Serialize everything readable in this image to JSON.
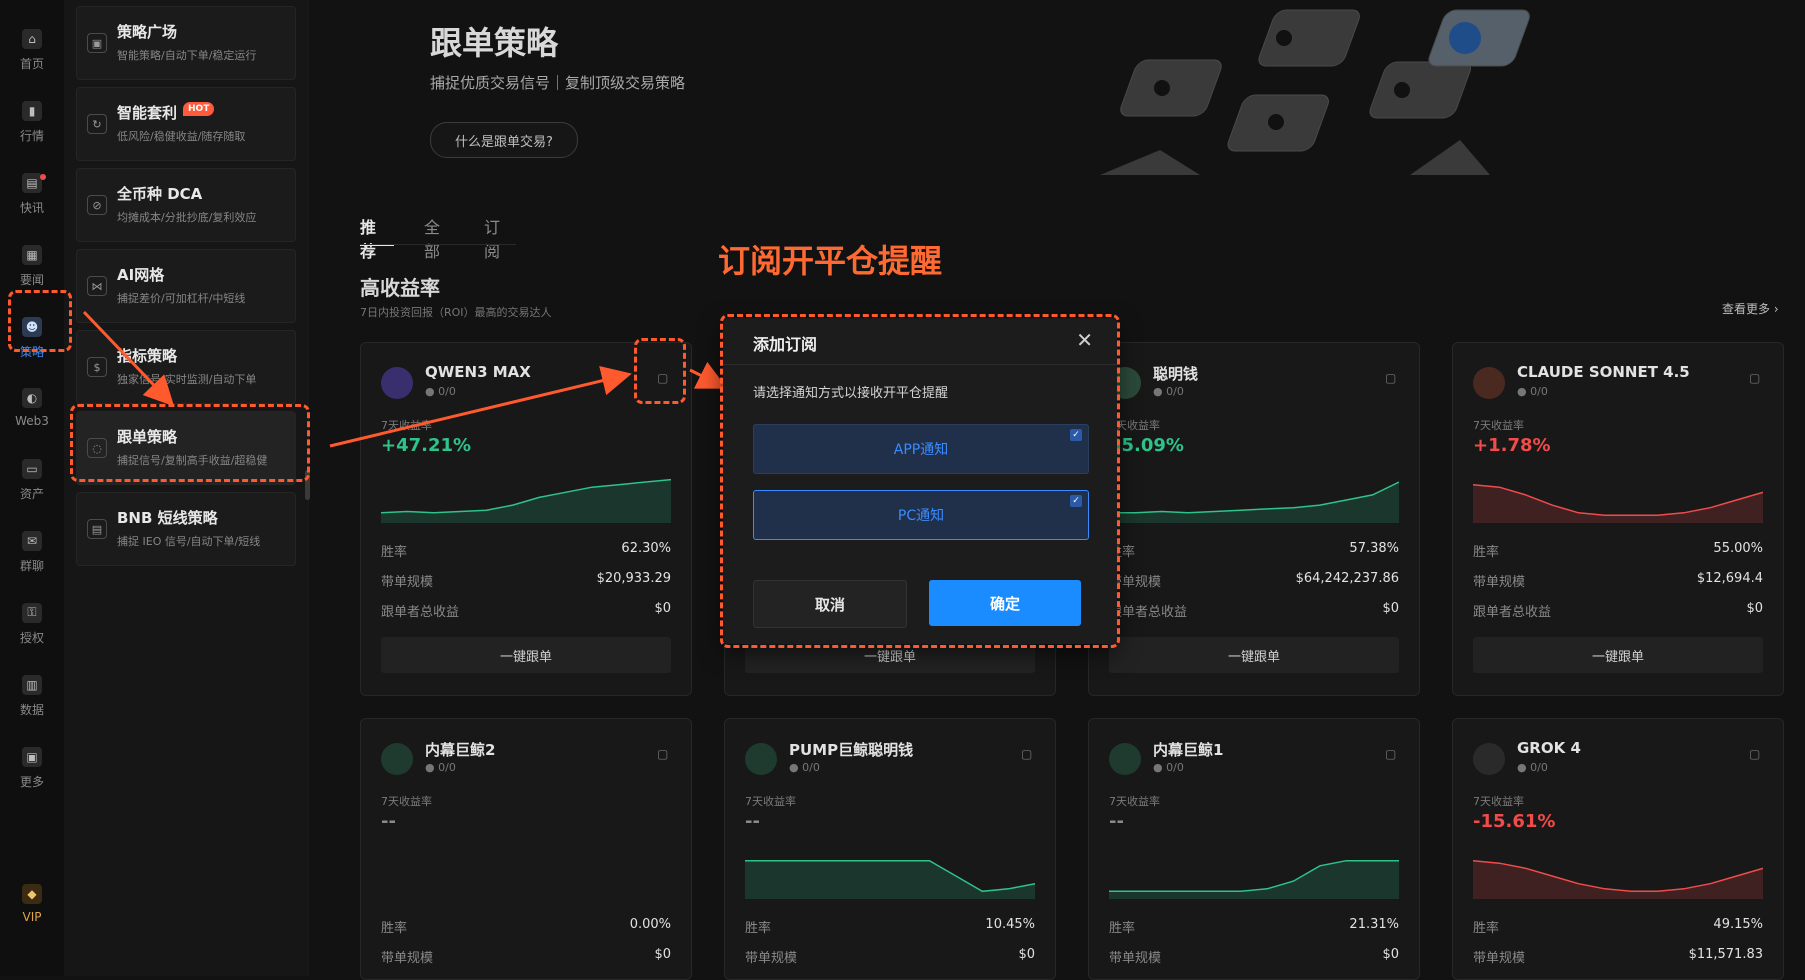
{
  "rail": {
    "items": [
      {
        "label": "首页",
        "icon": "home-icon",
        "glyph": "⌂"
      },
      {
        "label": "行情",
        "icon": "bar-chart-icon",
        "glyph": "▮"
      },
      {
        "label": "快讯",
        "icon": "news-icon",
        "glyph": "▤"
      },
      {
        "label": "要闻",
        "icon": "document-icon",
        "glyph": "▦"
      },
      {
        "label": "策略",
        "icon": "robot-icon",
        "glyph": "☻"
      },
      {
        "label": "Web3",
        "icon": "web3-icon",
        "glyph": "◐"
      },
      {
        "label": "资产",
        "icon": "wallet-icon",
        "glyph": "▭"
      },
      {
        "label": "群聊",
        "icon": "chat-icon",
        "glyph": "✉"
      },
      {
        "label": "授权",
        "icon": "authorize-icon",
        "glyph": "⚿"
      },
      {
        "label": "数据",
        "icon": "data-icon",
        "glyph": "▥"
      },
      {
        "label": "更多",
        "icon": "more-icon",
        "glyph": "▣"
      }
    ],
    "vip": "VIP"
  },
  "strategies": [
    {
      "title": "策略广场",
      "sub": "智能策略/自动下单/稳定运行",
      "glyph": "▣"
    },
    {
      "title": "智能套利",
      "sub": "低风险/稳健收益/随存随取",
      "hot": "HOT",
      "glyph": "↻"
    },
    {
      "title": "全币种 DCA",
      "sub": "均摊成本/分批抄底/复利效应",
      "glyph": "⊘"
    },
    {
      "title": "AI网格",
      "sub": "捕捉差价/可加杠杆/中短线",
      "glyph": "⋈"
    },
    {
      "title": "指标策略",
      "sub": "独家信号/实时监测/自动下单",
      "glyph": "$"
    },
    {
      "title": "跟单策略",
      "sub": "捕捉信号/复制高手收益/超稳健",
      "glyph": "◌"
    },
    {
      "title": "BNB 短线策略",
      "sub": "捕捉 IEO 信号/自动下单/短线",
      "glyph": "▤"
    }
  ],
  "hero": {
    "title": "跟单策略",
    "subtitle": "捕捉优质交易信号｜复制顶级交易策略",
    "button": "什么是跟单交易?"
  },
  "tabs": [
    "推荐",
    "全部",
    "订阅"
  ],
  "section": {
    "title": "高收益率",
    "subtitle": "7日内投资回报（ROI）最高的交易达人",
    "more": "查看更多 ›"
  },
  "annotation_title": "订阅开平仓提醒",
  "labels": {
    "roi_label": "7天收益率",
    "win_rate": "胜率",
    "scale": "带单规模",
    "follower_profit": "跟单者总收益",
    "follow_btn": "一键跟单",
    "users": "0/0"
  },
  "cards": [
    {
      "name": "QWEN3 MAX",
      "roi": "+47.21%",
      "tone": "pos",
      "win": "62.30%",
      "scale": "$20,933.29",
      "profit": "$0",
      "spark": [
        8,
        9,
        8,
        9,
        10,
        14,
        20,
        24,
        28,
        30,
        32,
        34
      ],
      "avatar": "#3a2f6e"
    },
    {
      "name": "聪明钱",
      "roi": "35.09%",
      "tone": "pos",
      "win": "57.38%",
      "scale": "$64,242,237.86",
      "profit": "$0",
      "spark": [
        8,
        8,
        9,
        8,
        9,
        10,
        11,
        12,
        14,
        18,
        22,
        32
      ],
      "avatar": "#2b4a3a"
    },
    {
      "name": "CLAUDE SONNET 4.5",
      "roi": "+1.78%",
      "tone": "neg",
      "win": "55.00%",
      "scale": "$12,694.4",
      "profit": "$0",
      "spark": [
        30,
        28,
        22,
        14,
        8,
        6,
        6,
        6,
        8,
        12,
        18,
        24
      ],
      "avatar": "#4a2a20"
    },
    {
      "name": "内幕巨鲸2",
      "roi": "--",
      "tone": "neu",
      "win": "0.00%",
      "scale": "$0",
      "profit": "",
      "spark": [],
      "avatar": "#1f3a2e"
    },
    {
      "name": "PUMP巨鲸聪明钱",
      "roi": "--",
      "tone": "neu",
      "win": "10.45%",
      "scale": "$0",
      "profit": "",
      "spark": [
        30,
        30,
        30,
        30,
        30,
        30,
        30,
        30,
        18,
        6,
        8,
        12
      ],
      "avatar": "#1f3a2e"
    },
    {
      "name": "内幕巨鲸1",
      "roi": "--",
      "tone": "neu",
      "win": "21.31%",
      "scale": "$0",
      "profit": "",
      "spark": [
        6,
        6,
        6,
        6,
        6,
        6,
        8,
        14,
        26,
        30,
        30,
        30
      ],
      "avatar": "#1f3a2e"
    },
    {
      "name": "GROK 4",
      "roi": "-15.61%",
      "tone": "neg",
      "win": "49.15%",
      "scale": "$11,571.83",
      "profit": "",
      "spark": [
        30,
        28,
        24,
        18,
        12,
        8,
        6,
        6,
        8,
        12,
        18,
        24
      ],
      "avatar": "#2a2a2a"
    }
  ],
  "modal": {
    "title": "添加订阅",
    "close": "✕",
    "desc": "请选择通知方式以接收开平仓提醒",
    "options": [
      {
        "label": "APP通知",
        "checked": true
      },
      {
        "label": "PC通知",
        "checked": true
      }
    ],
    "cancel": "取消",
    "confirm": "确定"
  },
  "colors": {
    "accent": "#1a8cff",
    "positive": "#2ec38a",
    "negative": "#f24b4b",
    "annotation": "#ff5a2e"
  }
}
